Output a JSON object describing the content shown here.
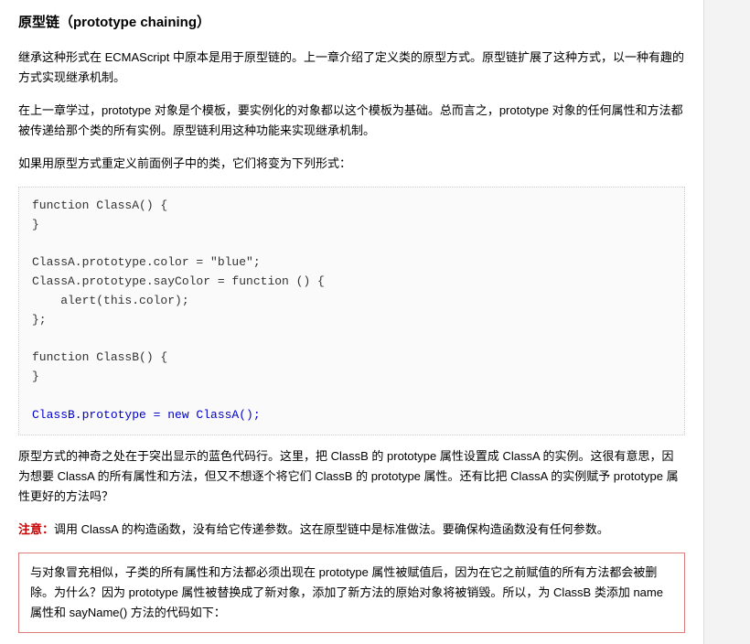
{
  "heading": "原型链（prototype chaining）",
  "para1": "继承这种形式在 ECMAScript 中原本是用于原型链的。上一章介绍了定义类的原型方式。原型链扩展了这种方式，以一种有趣的方式实现继承机制。",
  "para2": "在上一章学过，prototype 对象是个模板，要实例化的对象都以这个模板为基础。总而言之，prototype 对象的任何属性和方法都被传递给那个类的所有实例。原型链利用这种功能来实现继承机制。",
  "para3": "如果用原型方式重定义前面例子中的类，它们将变为下列形式：",
  "code": {
    "line1": "function ClassA() {",
    "line2": "}",
    "line3": "",
    "line4": "ClassA.prototype.color = \"blue\";",
    "line5": "ClassA.prototype.sayColor = function () {",
    "line6": "    alert(this.color);",
    "line7": "};",
    "line8": "",
    "line9": "function ClassB() {",
    "line10": "}",
    "line11": "",
    "line12": "ClassB.prototype = new ClassA();"
  },
  "para4": "原型方式的神奇之处在于突出显示的蓝色代码行。这里，把 ClassB 的 prototype 属性设置成 ClassA 的实例。这很有意思，因为想要 ClassA 的所有属性和方法，但又不想逐个将它们 ClassB 的 prototype 属性。还有比把 ClassA 的实例赋予 prototype 属性更好的方法吗？",
  "noteLabel": "注意：",
  "noteText": "调用 ClassA 的构造函数，没有给它传递参数。这在原型链中是标准做法。要确保构造函数没有任何参数。",
  "warning": "与对象冒充相似，子类的所有属性和方法都必须出现在 prototype 属性被赋值后，因为在它之前赋值的所有方法都会被删除。为什么？因为 prototype 属性被替换成了新对象，添加了新方法的原始对象将被销毁。所以，为 ClassB 类添加 name 属性和 sayName() 方法的代码如下："
}
